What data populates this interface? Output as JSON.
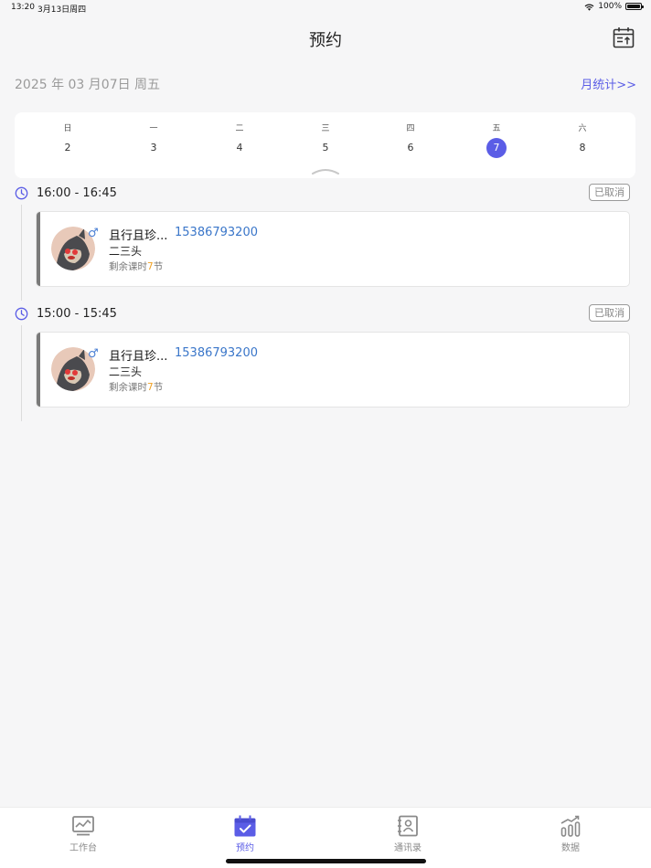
{
  "status_bar": {
    "time": "13:20",
    "date": "3月13日周四",
    "battery_text": "100%",
    "battery_level": 1.0
  },
  "header": {
    "title": "预约",
    "calendar_icon": "calendar-upload-icon"
  },
  "date_bar": {
    "full_date": "2025 年 03 月07日 周五",
    "month_stats": "月统计>>"
  },
  "week": {
    "days": [
      {
        "weekday": "日",
        "day": "2"
      },
      {
        "weekday": "一",
        "day": "3"
      },
      {
        "weekday": "二",
        "day": "4"
      },
      {
        "weekday": "三",
        "day": "5"
      },
      {
        "weekday": "四",
        "day": "6"
      },
      {
        "weekday": "五",
        "day": "7"
      },
      {
        "weekday": "六",
        "day": "8"
      }
    ],
    "selected_day": "7"
  },
  "appointments": [
    {
      "time_range": "16:00 - 16:45",
      "status": "已取消",
      "gender_symbol": "♂",
      "student_name": "且行且珍...",
      "phone": "15386793200",
      "course": "二三头",
      "remaining_prefix": "剩余课时",
      "remaining_count": "7",
      "remaining_suffix": "节"
    },
    {
      "time_range": "15:00 - 15:45",
      "status": "已取消",
      "gender_symbol": "♂",
      "student_name": "且行且珍...",
      "phone": "15386793200",
      "course": "二三头",
      "remaining_prefix": "剩余课时",
      "remaining_count": "7",
      "remaining_suffix": "节"
    }
  ],
  "tabs": [
    {
      "label": "工作台",
      "icon": "monitor-chart-icon",
      "active": false
    },
    {
      "label": "预约",
      "icon": "calendar-check-icon",
      "active": true
    },
    {
      "label": "通讯录",
      "icon": "contacts-icon",
      "active": false
    },
    {
      "label": "数据",
      "icon": "bar-chart-icon",
      "active": false
    }
  ],
  "colors": {
    "accent": "#5b5de6",
    "phone": "#3a76c9",
    "remaining_count": "#f0a020",
    "card_accent": "#7a7a7a"
  }
}
